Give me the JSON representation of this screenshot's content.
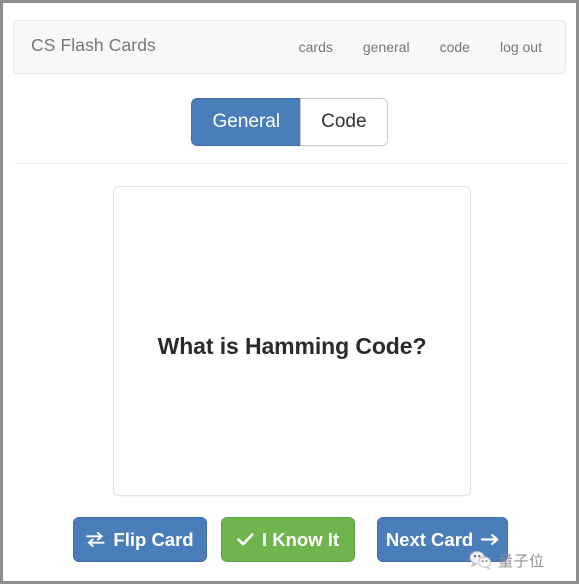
{
  "window": {
    "frame_color": "#8d8d8d",
    "page_background": "#ffffff"
  },
  "navbar": {
    "brand": "CS Flash Cards",
    "background": "#f8f8f8",
    "border_color": "#e7e7e7",
    "text_color": "#777777",
    "links": [
      {
        "label": "cards"
      },
      {
        "label": "general"
      },
      {
        "label": "code"
      },
      {
        "label": "log out"
      }
    ]
  },
  "category_toggle": {
    "active_color": "#4a7ebb",
    "inactive_color": "#ffffff",
    "selected": "General",
    "options": [
      {
        "label": "General",
        "active": true
      },
      {
        "label": "Code",
        "active": false
      }
    ]
  },
  "flashcard": {
    "front_text": "What is Hamming Code?",
    "border_color": "#e3e3e3",
    "background": "#ffffff"
  },
  "actions": {
    "flip": {
      "label": "Flip Card",
      "icon": "exchange-icon",
      "color": "#4a7ebb"
    },
    "know": {
      "label": "I Know It",
      "icon": "check-icon",
      "color": "#70b44e"
    },
    "next": {
      "label": "Next Card",
      "icon": "arrow-right-icon",
      "color": "#4a7ebb"
    }
  },
  "watermark": {
    "text": "量子位",
    "icon": "wechat-icon",
    "color": "#8a8a8a"
  }
}
